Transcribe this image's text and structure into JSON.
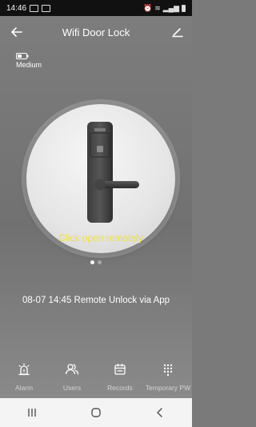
{
  "status_bar": {
    "time": "14:46",
    "icons": [
      "gallery-icon",
      "notification-icon"
    ],
    "right_icons": [
      "alarm-icon",
      "wifi-icon",
      "signal-icon",
      "battery-icon"
    ]
  },
  "header": {
    "title": "Wifi Door Lock",
    "back_icon": "back-arrow-icon",
    "edit_icon": "edit-pencil-icon"
  },
  "battery": {
    "level_label": "Medium",
    "icon": "battery-icon"
  },
  "unlock": {
    "prompt": "Click open remotely",
    "accent_color": "#f0e23c"
  },
  "pager": {
    "count": 2,
    "active": 0
  },
  "log": {
    "text": "08-07 14:45  Remote Unlock via App"
  },
  "tabs": [
    {
      "label": "Alarm",
      "icon": "alarm-bell-icon"
    },
    {
      "label": "Users",
      "icon": "users-icon"
    },
    {
      "label": "Records",
      "icon": "calendar-icon"
    },
    {
      "label": "Temporary PW",
      "icon": "keypad-icon"
    }
  ],
  "nav": [
    "recents-icon",
    "home-icon",
    "back-icon"
  ]
}
